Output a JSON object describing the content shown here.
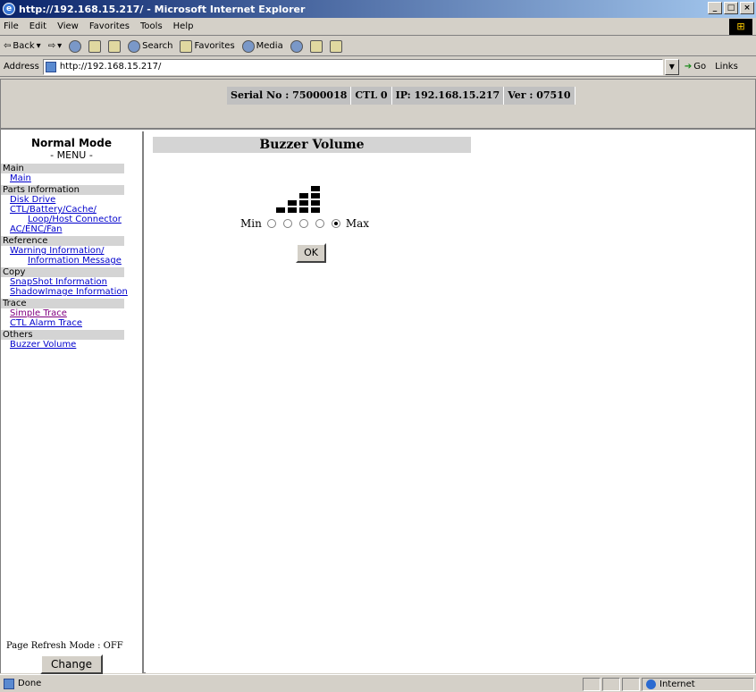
{
  "window": {
    "title": "http://192.168.15.217/ - Microsoft Internet Explorer",
    "controls": [
      "_",
      "□",
      "×"
    ]
  },
  "menubar": [
    "File",
    "Edit",
    "View",
    "Favorites",
    "Tools",
    "Help"
  ],
  "toolbar": {
    "back": "Back",
    "search": "Search",
    "favorites": "Favorites",
    "media": "Media"
  },
  "addressbar": {
    "label": "Address",
    "url": "http://192.168.15.217/",
    "go": "Go",
    "links": "Links"
  },
  "header": {
    "serial": "Serial No : 75000018",
    "ctl": "CTL 0",
    "ip": "IP: 192.168.15.217",
    "ver": "Ver : 07510"
  },
  "sidebar": {
    "title": "Normal Mode",
    "subtitle": "- MENU -",
    "sections": [
      {
        "label": "Main",
        "links": [
          "Main"
        ]
      },
      {
        "label": "Parts Information",
        "links": [
          "Disk Drive",
          "CTL/Battery/Cache/",
          "Loop/Host Connector",
          "AC/ENC/Fan"
        ]
      },
      {
        "label": "Reference",
        "links": [
          "Warning Information/",
          "Information Message"
        ]
      },
      {
        "label": "Copy",
        "links": [
          "SnapShot Information",
          "ShadowImage Information"
        ]
      },
      {
        "label": "Trace",
        "links": [
          "Simple Trace",
          "CTL Alarm Trace"
        ]
      },
      {
        "label": "Others",
        "links": [
          "Buzzer Volume"
        ]
      }
    ],
    "refresh_mode": "Page Refresh Mode : OFF",
    "change_label": "Change"
  },
  "main": {
    "heading": "Buzzer Volume",
    "min_label": "Min",
    "max_label": "Max",
    "levels": [
      0,
      1,
      2,
      3,
      4
    ],
    "selected_level": 4,
    "ok_label": "OK"
  },
  "statusbar": {
    "text": "Done",
    "zone": "Internet"
  }
}
